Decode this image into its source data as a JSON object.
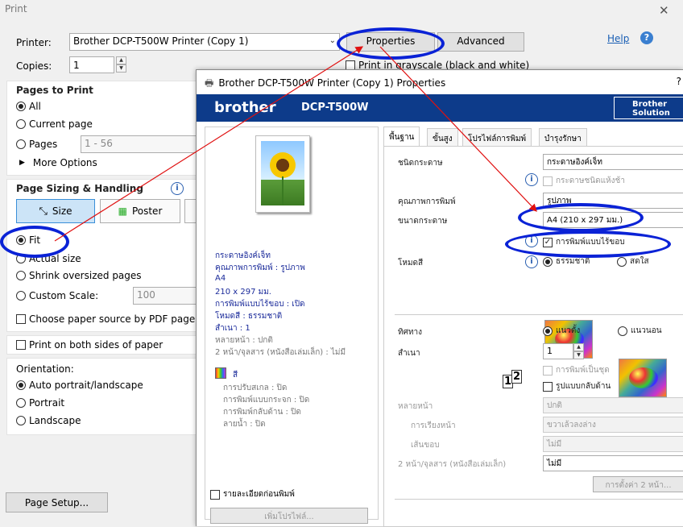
{
  "window": {
    "title": "Print"
  },
  "printer": {
    "label": "Printer:",
    "value": "Brother DCP-T500W Printer (Copy 1)",
    "properties_btn": "Properties",
    "advanced_btn": "Advanced",
    "help": "Help"
  },
  "copies": {
    "label": "Copies:",
    "value": "1"
  },
  "grayscale": {
    "label": "Print in grayscale (black and white)"
  },
  "pages": {
    "title": "Pages to Print",
    "all": "All",
    "current": "Current page",
    "pages": "Pages",
    "pages_value": "1 - 56",
    "more": "More Options"
  },
  "sizing": {
    "title": "Page Sizing & Handling",
    "size_btn": "Size",
    "poster_btn": "Poster",
    "fit": "Fit",
    "actual": "Actual size",
    "shrink": "Shrink oversized pages",
    "custom": "Custom Scale:",
    "custom_value": "100",
    "choose_source": "Choose paper source by PDF page size"
  },
  "both_sides": {
    "label": "Print on both sides of paper"
  },
  "orientation": {
    "title": "Orientation:",
    "auto": "Auto portrait/landscape",
    "portrait": "Portrait",
    "landscape": "Landscape"
  },
  "page_setup": {
    "label": "Page Setup..."
  },
  "properties": {
    "title": "Brother DCP-T500W Printer (Copy 1) Properties",
    "title_q": "?",
    "brand": "brother",
    "model": "DCP-T500W",
    "solutions_line1": "Brother",
    "solutions_line2": "Solution",
    "summary": {
      "media": "กระดาษอิงค์เจ็ท",
      "quality": "คุณภาพการพิมพ์ : รูปภาพ",
      "size": "A4",
      "dims": "210 x 297 มม.",
      "borderless": "การพิมพ์แบบไร้ขอบ : เปิด",
      "mode": "โหมดสี : ธรรมชาติ",
      "copies": "สำเนา : 1",
      "multi": "หลายหน้า : ปกติ",
      "booklet": "2 หน้า/จุลสาร (หนังสือเล่มเล็ก) : ไม่มี",
      "color": "สี",
      "scale": "การปรับสเกล : ปิด",
      "mirror": "การพิมพ์แบบกระจก : ปิด",
      "reverse": "การพิมพ์กลับด้าน : ปิด",
      "watermark": "ลายน้ำ : ปิด",
      "detail": "รายละเอียดก่อนพิมพ์",
      "add_profile": "เพิ่มโปรไฟล์..."
    },
    "tabs": [
      "พื้นฐาน",
      "ขั้นสูง",
      "โปรไฟล์การพิมพ์",
      "บำรุงรักษา"
    ],
    "basic": {
      "media_label": "ชนิดกระดาษ",
      "media_value": "กระดาษอิงค์เจ็ท",
      "slow_dry": "กระดาษชนิดแห้งช้า",
      "quality_label": "คุณภาพการพิมพ์",
      "quality_value": "รูปภาพ",
      "size_label": "ขนาดกระดาษ",
      "size_value": "A4 (210 x 297 มม.)",
      "borderless": "การพิมพ์แบบไร้ขอบ",
      "mode_label": "โหมดสี",
      "mode_a": "ธรรมชาติ",
      "mode_b": "สดใส",
      "orient_label": "ทิศทาง",
      "portrait": "แนวตั้ง",
      "landscape": "แนวนอน",
      "copies_label": "สำเนา",
      "copies_value": "1",
      "collate": "การพิมพ์เป็นชุด",
      "reverse": "รูปแบบกลับด้าน",
      "multi_label": "หลายหน้า",
      "multi_value": "ปกติ",
      "order_label": "การเรียงหน้า",
      "order_value": "ขวาเล้วลงล่าง",
      "border_label": "เส้นขอบ",
      "border_value": "ไม่มี",
      "booklet_label": "2 หน้า/จุลสาร (หนังสือเล่มเล็ก)",
      "booklet_value": "ไม่มี",
      "booklet_btn": "การตั้งค่า 2 หน้า..."
    }
  }
}
